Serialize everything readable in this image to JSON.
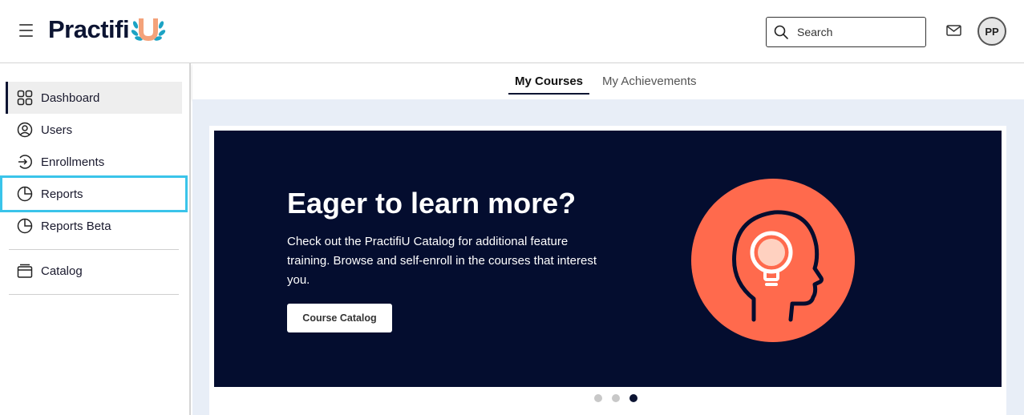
{
  "header": {
    "logo_text": "Practifi",
    "logo_u": "U",
    "search_placeholder": "Search",
    "avatar_initials": "PP"
  },
  "sidebar": {
    "items": [
      {
        "label": "Dashboard",
        "icon": "grid-icon"
      },
      {
        "label": "Users",
        "icon": "user-circle-icon"
      },
      {
        "label": "Enrollments",
        "icon": "enroll-icon"
      },
      {
        "label": "Reports",
        "icon": "pie-chart-icon"
      },
      {
        "label": "Reports Beta",
        "icon": "pie-chart-icon"
      },
      {
        "label": "Catalog",
        "icon": "catalog-icon"
      }
    ]
  },
  "tabs": [
    {
      "label": "My Courses"
    },
    {
      "label": "My Achievements"
    }
  ],
  "banner": {
    "title": "Eager to learn more?",
    "body": "Check out the PractifiU Catalog for additional feature training. Browse and self-enroll in the courses that interest you.",
    "button_label": "Course Catalog",
    "active_slide": 3,
    "slide_count": 3
  },
  "colors": {
    "brand_navy": "#0c1432",
    "accent_orange": "#ff6a4d",
    "focus_outline": "#3ac4ea",
    "banner_bg": "#040d2f"
  }
}
